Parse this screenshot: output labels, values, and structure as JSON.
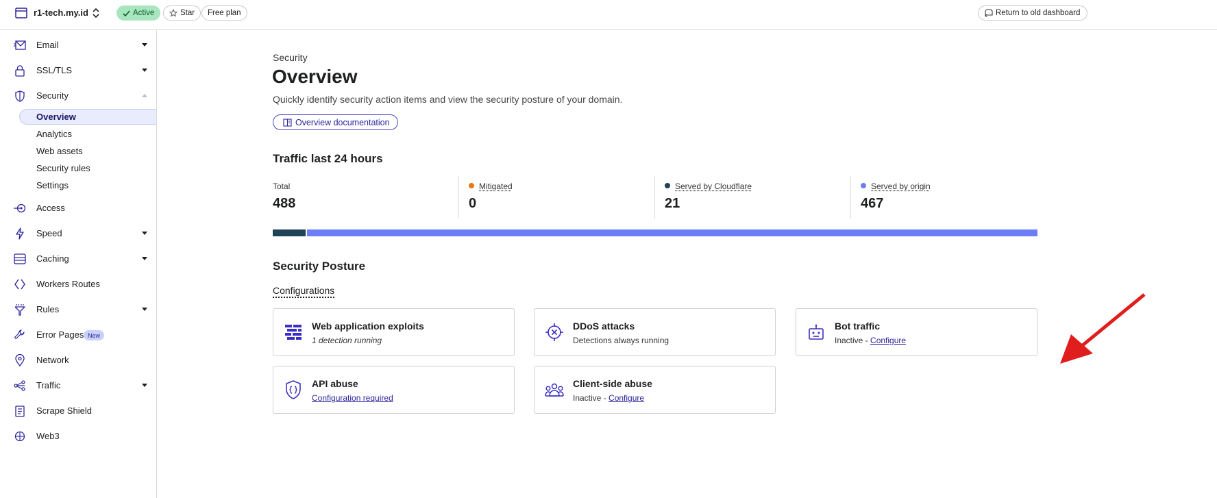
{
  "topbar": {
    "site_name": "r1-tech.my.id",
    "status": "Active",
    "star": "Star",
    "plan": "Free plan",
    "return_label": "Return to old dashboard"
  },
  "sidebar": {
    "items": [
      {
        "label": "Email",
        "icon": "envelope-icon",
        "caret": "down"
      },
      {
        "label": "SSL/TLS",
        "icon": "lock-icon",
        "caret": "down"
      },
      {
        "label": "Security",
        "icon": "shield-icon",
        "caret": "up"
      },
      {
        "label": "Access",
        "icon": "access-icon",
        "caret": "none"
      },
      {
        "label": "Speed",
        "icon": "lightning-icon",
        "caret": "down"
      },
      {
        "label": "Caching",
        "icon": "server-stack-icon",
        "caret": "down"
      },
      {
        "label": "Workers Routes",
        "icon": "workers-icon",
        "caret": "none"
      },
      {
        "label": "Rules",
        "icon": "funnel-icon",
        "caret": "down"
      },
      {
        "label": "Error Pages",
        "icon": "wrench-icon",
        "caret": "none",
        "badge": "New"
      },
      {
        "label": "Network",
        "icon": "location-pin-icon",
        "caret": "none"
      },
      {
        "label": "Traffic",
        "icon": "traffic-nodes-icon",
        "caret": "down"
      },
      {
        "label": "Scrape Shield",
        "icon": "document-icon",
        "caret": "none"
      },
      {
        "label": "Web3",
        "icon": "web3-icon",
        "caret": "none"
      }
    ],
    "security_sub": [
      "Overview",
      "Analytics",
      "Web assets",
      "Security rules",
      "Settings"
    ],
    "selected_sub": "Overview"
  },
  "main": {
    "eyebrow": "Security",
    "title": "Overview",
    "description": "Quickly identify security action items and view the security posture of your domain.",
    "doc_button": "Overview documentation",
    "traffic_title": "Traffic last 24 hours",
    "stats": [
      {
        "label": "Total",
        "value": "488",
        "dot_color": ""
      },
      {
        "label": "Mitigated",
        "value": "0",
        "dot_color": "#e8780f"
      },
      {
        "label": "Served by Cloudflare",
        "value": "21",
        "dot_color": "#1f4356"
      },
      {
        "label": "Served by origin",
        "value": "467",
        "dot_color": "#6d7df5"
      }
    ],
    "traffic_share": {
      "served_by_cloudflare": 21,
      "served_by_origin": 467
    },
    "posture_title": "Security Posture",
    "configurations_tab": "Configurations",
    "cards": [
      {
        "title": "Web application exploits",
        "sub_text": "1 detection running",
        "sub_link": "",
        "icon": "firewall-icon"
      },
      {
        "title": "DDoS attacks",
        "sub_text": "Detections always running",
        "sub_link": "",
        "icon": "ddos-target-icon"
      },
      {
        "title": "Bot traffic",
        "sub_text": "Inactive - ",
        "sub_link": "Configure",
        "icon": "robot-icon"
      },
      {
        "title": "API abuse",
        "sub_text": "",
        "sub_link": "Configuration required",
        "icon": "api-shield-icon"
      },
      {
        "title": "Client-side abuse",
        "sub_text": "Inactive - ",
        "sub_link": "Configure",
        "icon": "users-group-icon"
      }
    ]
  },
  "colors": {
    "accent": "#2c2499",
    "active_pill": "#a8e6bf",
    "cloudflare_bar": "#1f4356",
    "origin_bar": "#6d7df5",
    "mitigated_dot": "#e8780f",
    "annotation_arrow": "#e01e1e"
  }
}
